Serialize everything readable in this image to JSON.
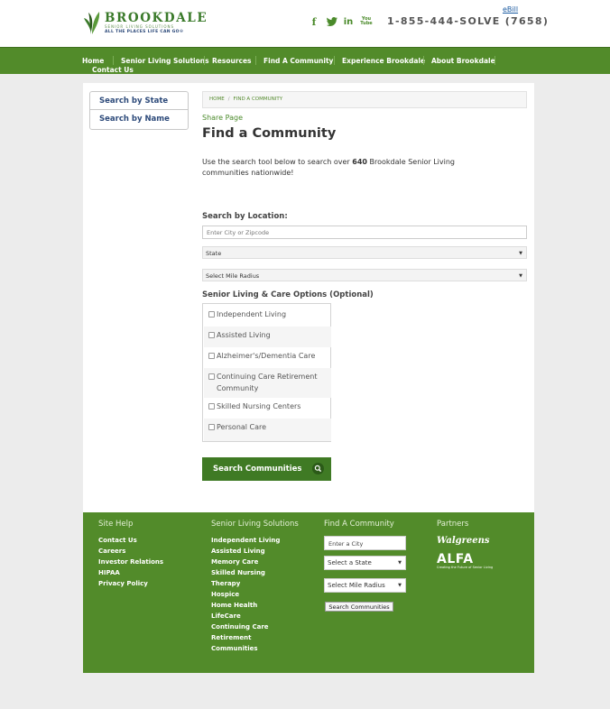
{
  "header": {
    "logo": {
      "name": "BROOKDALE",
      "subtitle": "SENIOR LIVING SOLUTIONS",
      "tagline": "ALL THE PLACES LIFE CAN GO®"
    },
    "ebill": "eBill",
    "social": {
      "facebook": "f",
      "linkedin": "in",
      "youtube": "You Tube"
    },
    "phone": "1-855-444-SOLVE (7658)"
  },
  "nav": {
    "items": [
      "Home",
      "Senior Living Solutions",
      "Resources",
      "Find A Community",
      "Experience Brookdale",
      "About Brookdale",
      "Contact Us"
    ]
  },
  "sidebar": {
    "tabs": [
      "Search by State",
      "Search by Name"
    ]
  },
  "breadcrumb": {
    "home": "HOME",
    "sep": "/",
    "current": "FIND A COMMUNITY"
  },
  "main": {
    "share": "Share Page",
    "title": "Find a Community",
    "intro_before": "Use the search tool below to search over ",
    "intro_count": "640",
    "intro_after": " Brookdale Senior Living communities nationwide!",
    "location_label": "Search by Location:",
    "location_placeholder": "Enter City or Zipcode",
    "state_select": "State",
    "radius_select": "Select Mile Radius",
    "care_label": "Senior Living & Care Options (Optional)",
    "care_options": [
      "Independent Living",
      "Assisted Living",
      "Alzheimer's/Dementia Care",
      "Continuing Care Retirement Community",
      "Skilled Nursing Centers",
      "Personal Care"
    ],
    "search_button": "Search Communities"
  },
  "footer": {
    "site_help": {
      "heading": "Site Help",
      "links": [
        "Contact Us",
        "Careers",
        "Investor Relations",
        "HIPAA",
        "Privacy Policy"
      ]
    },
    "solutions": {
      "heading": "Senior Living Solutions",
      "links": [
        "Independent Living",
        "Assisted Living",
        "Memory Care",
        "Skilled Nursing",
        "Therapy",
        "Hospice",
        "Home Health",
        "LifeCare",
        "Continuing Care",
        "Retirement",
        "Communities"
      ]
    },
    "find": {
      "heading": "Find A Community",
      "city_placeholder": "Enter a City",
      "state_select": "Select a State",
      "radius_select": "Select Mile Radius",
      "button": "Search Communities"
    },
    "partners": {
      "heading": "Partners",
      "walgreens": "Walgreens",
      "alfa": "ALFA",
      "alfa_tag": "Creating the Future of Senior Living"
    }
  },
  "colors": {
    "brand_green": "#528b2a",
    "dark_green": "#3f7a24",
    "navy": "#2d4a7a"
  }
}
